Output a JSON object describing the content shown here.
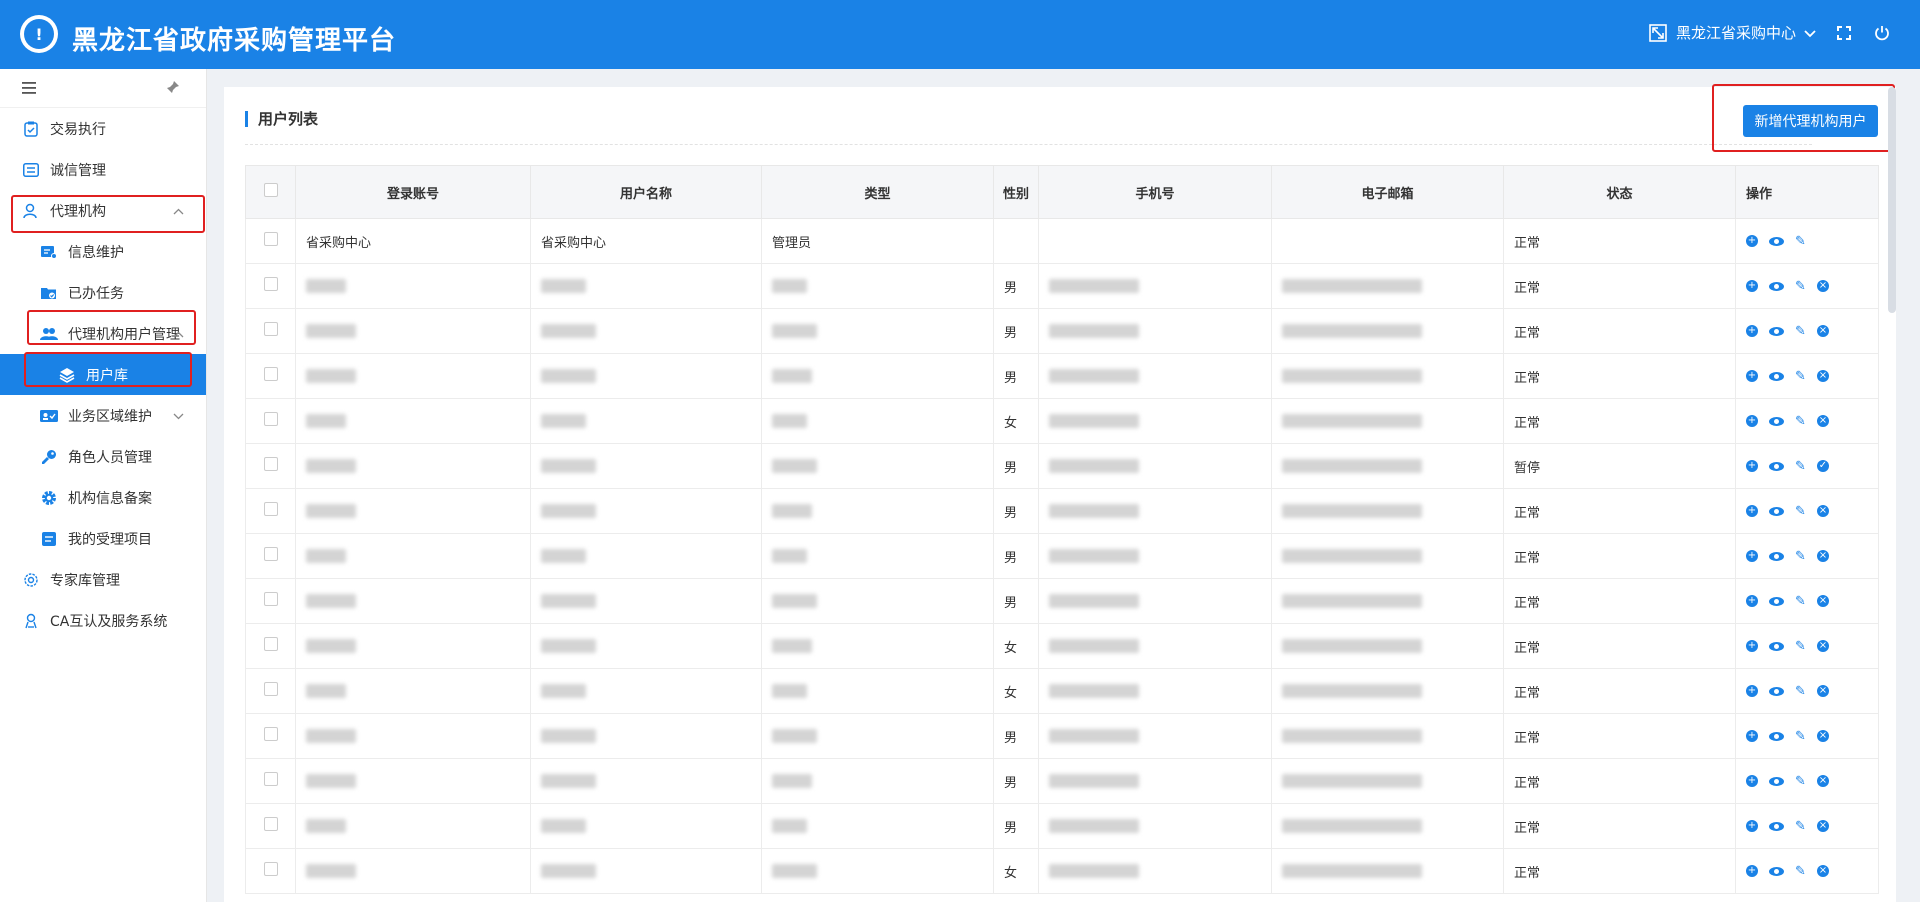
{
  "header": {
    "title": "黑龙江省政府采购管理平台",
    "org": "黑龙江省采购中心"
  },
  "sidebar": {
    "items": [
      {
        "label": "交易执行"
      },
      {
        "label": "诚信管理"
      },
      {
        "label": "代理机构"
      },
      {
        "label": "信息维护"
      },
      {
        "label": "已办任务"
      },
      {
        "label": "代理机构用户管理"
      },
      {
        "label": "用户库"
      },
      {
        "label": "业务区域维护"
      },
      {
        "label": "角色人员管理"
      },
      {
        "label": "机构信息备案"
      },
      {
        "label": "我的受理项目"
      },
      {
        "label": "专家库管理"
      },
      {
        "label": "CA互认及服务系统"
      }
    ]
  },
  "panel": {
    "title": "用户列表",
    "add_button": "新增代理机构用户"
  },
  "table": {
    "columns": [
      "登录账号",
      "用户名称",
      "类型",
      "性别",
      "手机号",
      "电子邮箱",
      "状态",
      "操作"
    ],
    "rows": [
      {
        "account": "省采购中心",
        "name": "省采购中心",
        "type": "管理员",
        "gender": "",
        "status": "正常"
      },
      {
        "gender": "男",
        "status": "正常"
      },
      {
        "gender": "男",
        "status": "正常"
      },
      {
        "gender": "男",
        "status": "正常"
      },
      {
        "gender": "女",
        "status": "正常"
      },
      {
        "gender": "男",
        "status": "暂停"
      },
      {
        "gender": "男",
        "status": "正常"
      },
      {
        "gender": "男",
        "status": "正常"
      },
      {
        "gender": "男",
        "status": "正常"
      },
      {
        "gender": "女",
        "status": "正常"
      },
      {
        "gender": "女",
        "status": "正常"
      },
      {
        "gender": "男",
        "status": "正常"
      },
      {
        "gender": "男",
        "status": "正常"
      },
      {
        "gender": "男",
        "status": "正常"
      },
      {
        "gender": "女",
        "status": "正常"
      }
    ]
  },
  "colors": {
    "primary": "#1a82e6",
    "highlight": "#e02020"
  }
}
